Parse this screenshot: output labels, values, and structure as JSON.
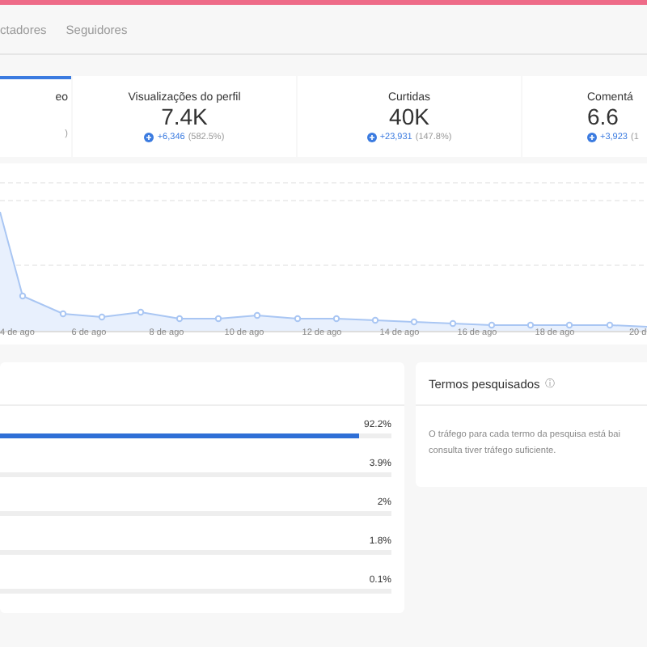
{
  "tabs": [
    {
      "label": "ctadores",
      "selected": false
    },
    {
      "label": "Seguidores",
      "selected": false
    }
  ],
  "metrics": [
    {
      "title": "eo",
      "change": ")",
      "selected": true
    },
    {
      "title": "Visualizações do perfil",
      "value": "7.4K",
      "delta": "+6,346",
      "change": "(582.5%)",
      "selected": false
    },
    {
      "title": "Curtidas",
      "value": "40K",
      "delta": "+23,931",
      "change": "(147.8%)",
      "selected": false
    },
    {
      "title": "Comentá",
      "value": "6.6",
      "delta": "+3,923",
      "change": "(1",
      "selected": false
    }
  ],
  "chart": {
    "x_labels": [
      "4 de ago",
      "6 de ago",
      "8 de ago",
      "10 de ago",
      "12 de ago",
      "14 de ago",
      "16 de ago",
      "18 de ago",
      "20 d"
    ]
  },
  "traffic": {
    "rows": [
      {
        "reading": "92.2%",
        "level": 0.922
      },
      {
        "reading": "3.9%",
        "level": 0.039
      },
      {
        "reading": "2%",
        "level": 0.02
      },
      {
        "reading": "1.8%",
        "level": 0.018
      },
      {
        "reading": "0.1%",
        "level": 0.001
      }
    ]
  },
  "search_terms": {
    "title": "Termos pesquisados",
    "info": "ⓘ",
    "lines": [
      "O tráfego para cada termo da pesquisa está bai",
      "consulta tiver tráfego suficiente."
    ]
  }
}
